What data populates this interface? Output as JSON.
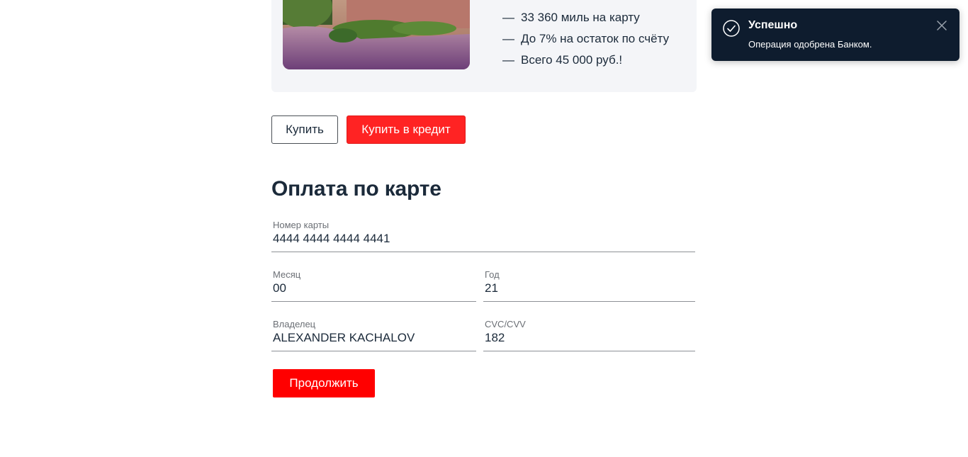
{
  "offer": {
    "features": [
      "33 360 миль на карту",
      "До 7% на остаток по счёту",
      "Всего 45 000 руб.!"
    ],
    "dash": "—"
  },
  "actions": {
    "buy_label": "Купить",
    "buy_credit_label": "Купить в кредит"
  },
  "payment_form": {
    "title": "Оплата по карте",
    "card_number": {
      "label": "Номер карты",
      "value": "4444 4444 4444 4441"
    },
    "month": {
      "label": "Месяц",
      "value": "00"
    },
    "year": {
      "label": "Год",
      "value": "21"
    },
    "owner": {
      "label": "Владелец",
      "value": "ALEXANDER KACHALOV"
    },
    "cvc": {
      "label": "CVC/CVV",
      "value": "182"
    },
    "continue_label": "Продолжить"
  },
  "toast": {
    "title": "Успешно",
    "message": "Операция одобрена Банком.",
    "icon": "check-circle-icon",
    "close_icon": "close-icon"
  },
  "colors": {
    "accent_red": "#ff2323",
    "toast_bg": "#0e1c2e",
    "card_bg": "#f4f5f8"
  }
}
